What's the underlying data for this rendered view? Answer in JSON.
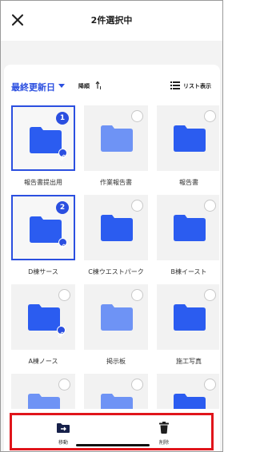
{
  "header": {
    "title": "2件選択中"
  },
  "toolbar": {
    "sort_field": "最終更新日",
    "sort_order": "降順",
    "view_toggle": "リスト表示"
  },
  "colors": {
    "accent": "#2b4fe0",
    "folder_dark": "#2b5cf0",
    "folder_light": "#6e93f5",
    "highlight_border": "#e0151b"
  },
  "folders": [
    {
      "name": "報告書提出用",
      "selected": true,
      "badge": "1",
      "linked": true,
      "shade": "dark"
    },
    {
      "name": "作業報告書",
      "selected": false,
      "badge": "",
      "linked": false,
      "shade": "light"
    },
    {
      "name": "報告書",
      "selected": false,
      "badge": "",
      "linked": false,
      "shade": "dark"
    },
    {
      "name": "D棟サース",
      "selected": true,
      "badge": "2",
      "linked": true,
      "shade": "dark"
    },
    {
      "name": "C棟ウエストパーク",
      "selected": false,
      "badge": "",
      "linked": false,
      "shade": "dark"
    },
    {
      "name": "B棟イースト",
      "selected": false,
      "badge": "",
      "linked": false,
      "shade": "dark"
    },
    {
      "name": "A棟ノース",
      "selected": false,
      "badge": "",
      "linked": true,
      "shade": "dark"
    },
    {
      "name": "掲示板",
      "selected": false,
      "badge": "",
      "linked": false,
      "shade": "light"
    },
    {
      "name": "施工写真",
      "selected": false,
      "badge": "",
      "linked": false,
      "shade": "dark"
    },
    {
      "name": "",
      "selected": false,
      "badge": "",
      "linked": false,
      "shade": "light"
    },
    {
      "name": "",
      "selected": false,
      "badge": "",
      "linked": false,
      "shade": "light"
    },
    {
      "name": "",
      "selected": false,
      "badge": "",
      "linked": false,
      "shade": "dark"
    }
  ],
  "bottom_bar": {
    "move_label": "移動",
    "delete_label": "削除"
  }
}
